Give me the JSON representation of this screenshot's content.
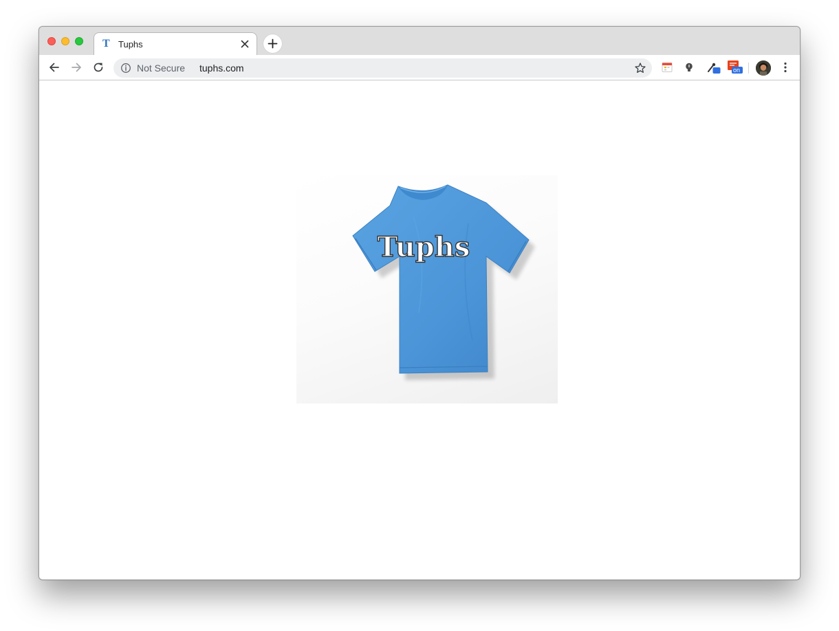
{
  "tab": {
    "favicon_letter": "T",
    "title": "Tuphs"
  },
  "address_bar": {
    "security_label": "Not Secure",
    "url": "tuphs.com"
  },
  "extensions": {
    "extension_badge": "on"
  },
  "product": {
    "shirt_color": "#4b95d8",
    "shirt_text": "Tuphs"
  },
  "icons": [
    "back-arrow-icon",
    "forward-arrow-icon",
    "reload-icon",
    "info-icon",
    "star-icon",
    "close-icon",
    "plus-icon",
    "menu-dots-icon"
  ]
}
